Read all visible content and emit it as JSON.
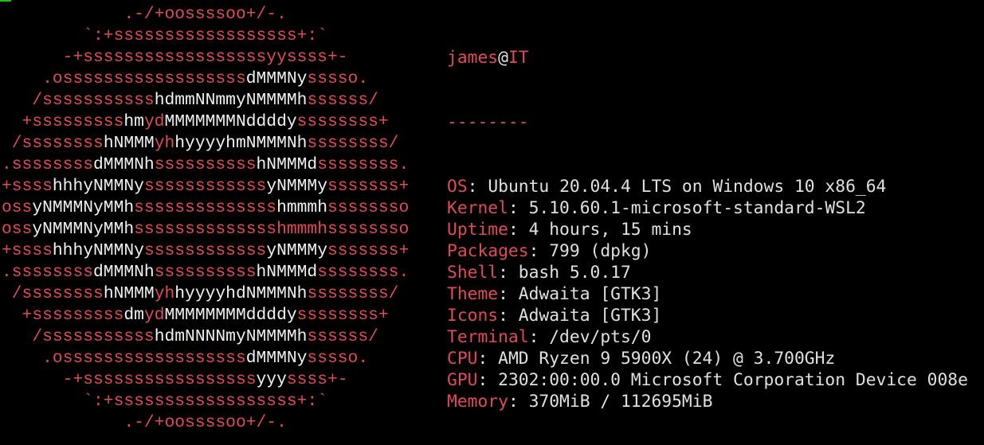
{
  "colors": {
    "background": "#000000",
    "accent": "#e24a55",
    "text": "#e0e0e0",
    "logo_highlight": "#f2f2f2"
  },
  "logo": {
    "lines": [
      [
        [
          "r",
          "            .-/+oossssoo+/-."
        ]
      ],
      [
        [
          "r",
          "        `:+ssssssssssssssssss+:`"
        ]
      ],
      [
        [
          "r",
          "      -+ssssssssssssssssssyyssss+-"
        ]
      ],
      [
        [
          "r",
          "    .ossssssssssssssssss"
        ],
        [
          "w",
          "dMMMNy"
        ],
        [
          "r",
          "sssso."
        ]
      ],
      [
        [
          "r",
          "   /sssssssssss"
        ],
        [
          "w",
          "hdmmNNmmyNMMMMh"
        ],
        [
          "r",
          "ssssss/"
        ]
      ],
      [
        [
          "r",
          "  +sssssssss"
        ],
        [
          "w",
          "hm"
        ],
        [
          "r",
          "yd"
        ],
        [
          "w",
          "MMMMMMMNddddy"
        ],
        [
          "r",
          "ssssssss+"
        ]
      ],
      [
        [
          "r",
          " /ssssssss"
        ],
        [
          "w",
          "hNMMM"
        ],
        [
          "r",
          "yh"
        ],
        [
          "w",
          "hyyyyhmNMMMNh"
        ],
        [
          "r",
          "ssssssss/"
        ]
      ],
      [
        [
          "r",
          ".ssssssss"
        ],
        [
          "w",
          "dMMMNh"
        ],
        [
          "r",
          "ssssssssss"
        ],
        [
          "w",
          "hNMMMd"
        ],
        [
          "r",
          "ssssssss."
        ]
      ],
      [
        [
          "r",
          "+ssss"
        ],
        [
          "w",
          "hhhyNMMNy"
        ],
        [
          "r",
          "ssssssssssss"
        ],
        [
          "w",
          "yNMMMy"
        ],
        [
          "r",
          "sssssss+"
        ]
      ],
      [
        [
          "r",
          "oss"
        ],
        [
          "w",
          "yNMMMNyMMh"
        ],
        [
          "r",
          "ssssssssssssss"
        ],
        [
          "w",
          "hmmmh"
        ],
        [
          "r",
          "ssssssso"
        ]
      ],
      [
        [
          "r",
          "oss"
        ],
        [
          "w",
          "yNMMMNyMMh"
        ],
        [
          "r",
          "sssssssssssssshmmmhssssssso"
        ]
      ],
      [
        [
          "r",
          "+ssss"
        ],
        [
          "w",
          "hhhyNMMNy"
        ],
        [
          "r",
          "ssssssssssss"
        ],
        [
          "w",
          "yNMMMy"
        ],
        [
          "r",
          "sssssss+"
        ]
      ],
      [
        [
          "r",
          ".ssssssss"
        ],
        [
          "w",
          "dMMMNh"
        ],
        [
          "r",
          "ssssssssss"
        ],
        [
          "w",
          "hNMMMd"
        ],
        [
          "r",
          "ssssssss."
        ]
      ],
      [
        [
          "r",
          " /ssssssss"
        ],
        [
          "w",
          "hNMMM"
        ],
        [
          "r",
          "yh"
        ],
        [
          "w",
          "hyyyyhdNMMMNh"
        ],
        [
          "r",
          "ssssssss/"
        ]
      ],
      [
        [
          "r",
          "  +sssssssss"
        ],
        [
          "w",
          "dm"
        ],
        [
          "r",
          "yd"
        ],
        [
          "w",
          "MMMMMMMMddddy"
        ],
        [
          "r",
          "ssssssss+"
        ]
      ],
      [
        [
          "r",
          "   /sssssssssss"
        ],
        [
          "w",
          "hdmNNNNmyNMMMMh"
        ],
        [
          "r",
          "ssssss/"
        ]
      ],
      [
        [
          "r",
          "    .ossssssssssssssssss"
        ],
        [
          "w",
          "dMMMNy"
        ],
        [
          "r",
          "sssso."
        ]
      ],
      [
        [
          "r",
          "      -+sssssssssssssssss"
        ],
        [
          "w",
          "yyy"
        ],
        [
          "r",
          "ssss+-"
        ]
      ],
      [
        [
          "r",
          "        `:+ssssssssssssssssss+:`"
        ]
      ],
      [
        [
          "r",
          "            .-/+oossssoo+/-."
        ]
      ]
    ]
  },
  "header": {
    "user": "james",
    "at": "@",
    "host": "IT",
    "separator": "--------"
  },
  "info": [
    {
      "key": "OS",
      "value": "Ubuntu 20.04.4 LTS on Windows 10 x86_64"
    },
    {
      "key": "Kernel",
      "value": "5.10.60.1-microsoft-standard-WSL2"
    },
    {
      "key": "Uptime",
      "value": "4 hours, 15 mins"
    },
    {
      "key": "Packages",
      "value": "799 (dpkg)"
    },
    {
      "key": "Shell",
      "value": "bash 5.0.17"
    },
    {
      "key": "Theme",
      "value": "Adwaita [GTK3]"
    },
    {
      "key": "Icons",
      "value": "Adwaita [GTK3]"
    },
    {
      "key": "Terminal",
      "value": "/dev/pts/0"
    },
    {
      "key": "CPU",
      "value": "AMD Ryzen 9 5900X (24) @ 3.700GHz"
    },
    {
      "key": "GPU",
      "value": "2302:00:00.0 Microsoft Corporation Device 008e"
    },
    {
      "key": "Memory",
      "value": "370MiB / 112695MiB"
    }
  ]
}
